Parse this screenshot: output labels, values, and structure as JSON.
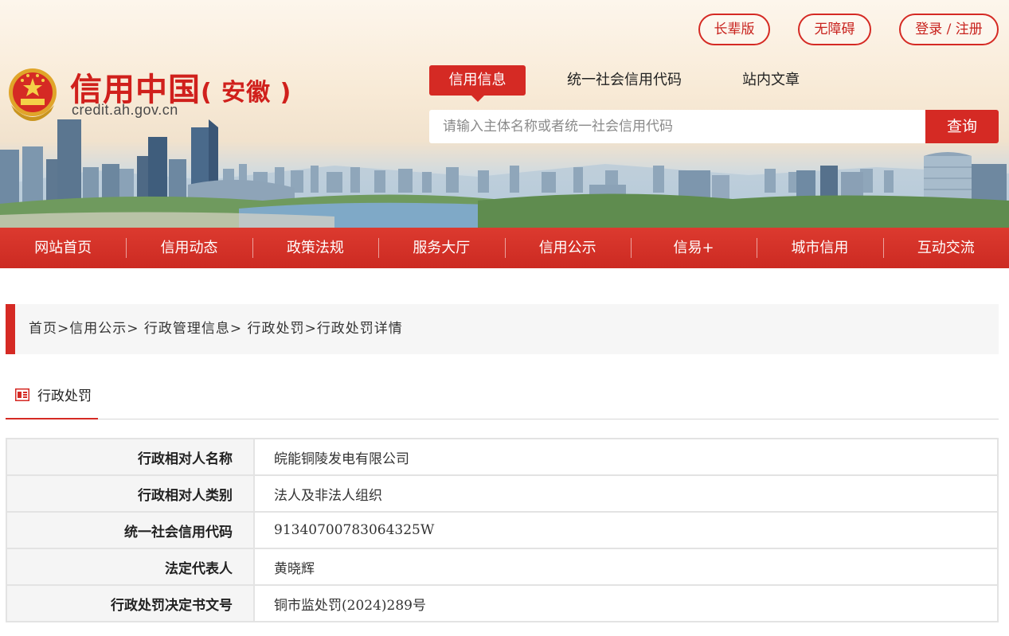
{
  "header": {
    "top_buttons": [
      "长辈版",
      "无障碍",
      "登录 / 注册"
    ],
    "logo": {
      "title": "信用中国",
      "region": "( 安徽 )",
      "url": "credit.ah.gov.cn",
      "emblem_icon": "national-emblem-icon"
    },
    "search": {
      "tabs": [
        "信用信息",
        "统一社会信用代码",
        "站内文章"
      ],
      "active_tab": "信用信息",
      "placeholder": "请输入主体名称或者统一社会信用代码",
      "value": "",
      "button_label": "查询"
    }
  },
  "nav": {
    "items": [
      "网站首页",
      "信用动态",
      "政策法规",
      "服务大厅",
      "信用公示",
      "信易+",
      "城市信用",
      "互动交流"
    ]
  },
  "breadcrumb": {
    "items": [
      "首页",
      "信用公示",
      " 行政管理信息",
      " 行政处罚",
      "行政处罚详情"
    ],
    "separator": ">"
  },
  "section": {
    "title": "行政处罚",
    "icon": "list-doc-icon"
  },
  "detail": {
    "rows": [
      {
        "label": "行政相对人名称",
        "value": "皖能铜陵发电有限公司"
      },
      {
        "label": "行政相对人类别",
        "value": "法人及非法人组织"
      },
      {
        "label": "统一社会信用代码",
        "value": "91340700783064325W"
      },
      {
        "label": "法定代表人",
        "value": "黄晓辉"
      },
      {
        "label": "行政处罚决定书文号",
        "value": "铜市监处罚(2024)289号"
      }
    ]
  },
  "colors": {
    "accent": "#d52a24",
    "nav_bg": "#d3312a",
    "breadcrumb_bg": "#f6f6f6",
    "table_label_bg": "#f5f5f5"
  }
}
